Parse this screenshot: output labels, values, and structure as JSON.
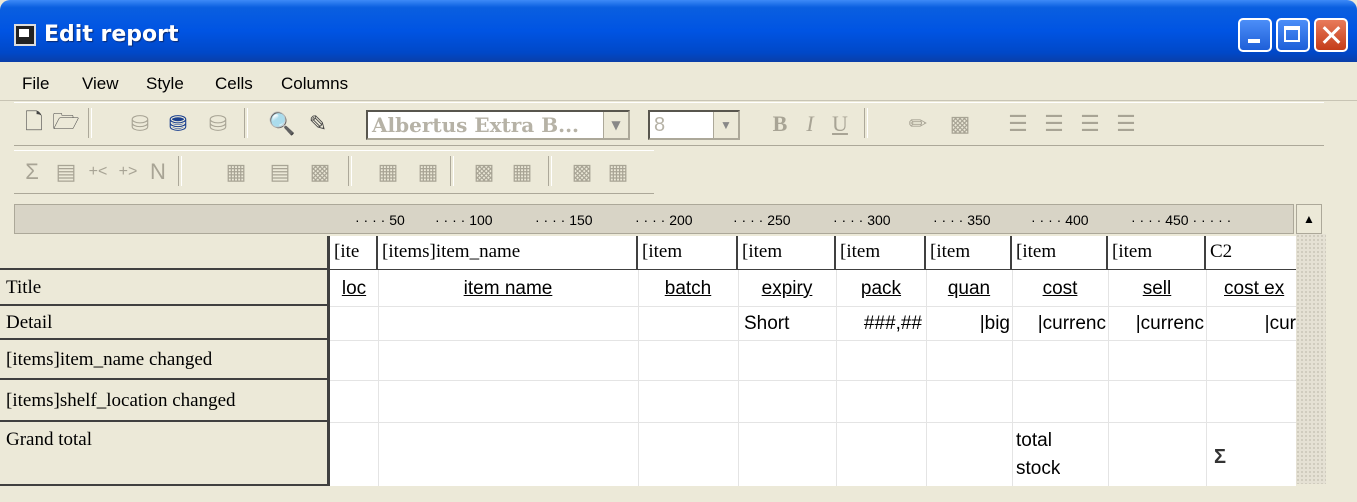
{
  "window": {
    "title": "Edit report"
  },
  "menu": [
    "File",
    "View",
    "Style",
    "Cells",
    "Columns"
  ],
  "toolbar": {
    "font_name": "Albertus Extra B...",
    "font_size": "8"
  },
  "ruler": [
    "50",
    "100",
    "150",
    "200",
    "250",
    "300",
    "350",
    "400",
    "450"
  ],
  "columns": [
    "[ite",
    "[items]item_name",
    "[item",
    "[item",
    "[item",
    "[item",
    "[item",
    "[item",
    "C2"
  ],
  "rows": [
    "Title",
    "Detail",
    "[items]item_name changed",
    "[items]shelf_location changed",
    "Grand total"
  ],
  "title_row": [
    "loc",
    "item name",
    "batch",
    "expiry",
    "pack",
    "quan",
    "cost",
    "sell",
    "cost ex"
  ],
  "detail_row": [
    "",
    "",
    "",
    "Short",
    "###,##",
    "|big",
    "|currenc",
    "|currenc",
    "|cur"
  ],
  "grand_total": {
    "cost_line1": "total",
    "cost_line2": "stock"
  }
}
